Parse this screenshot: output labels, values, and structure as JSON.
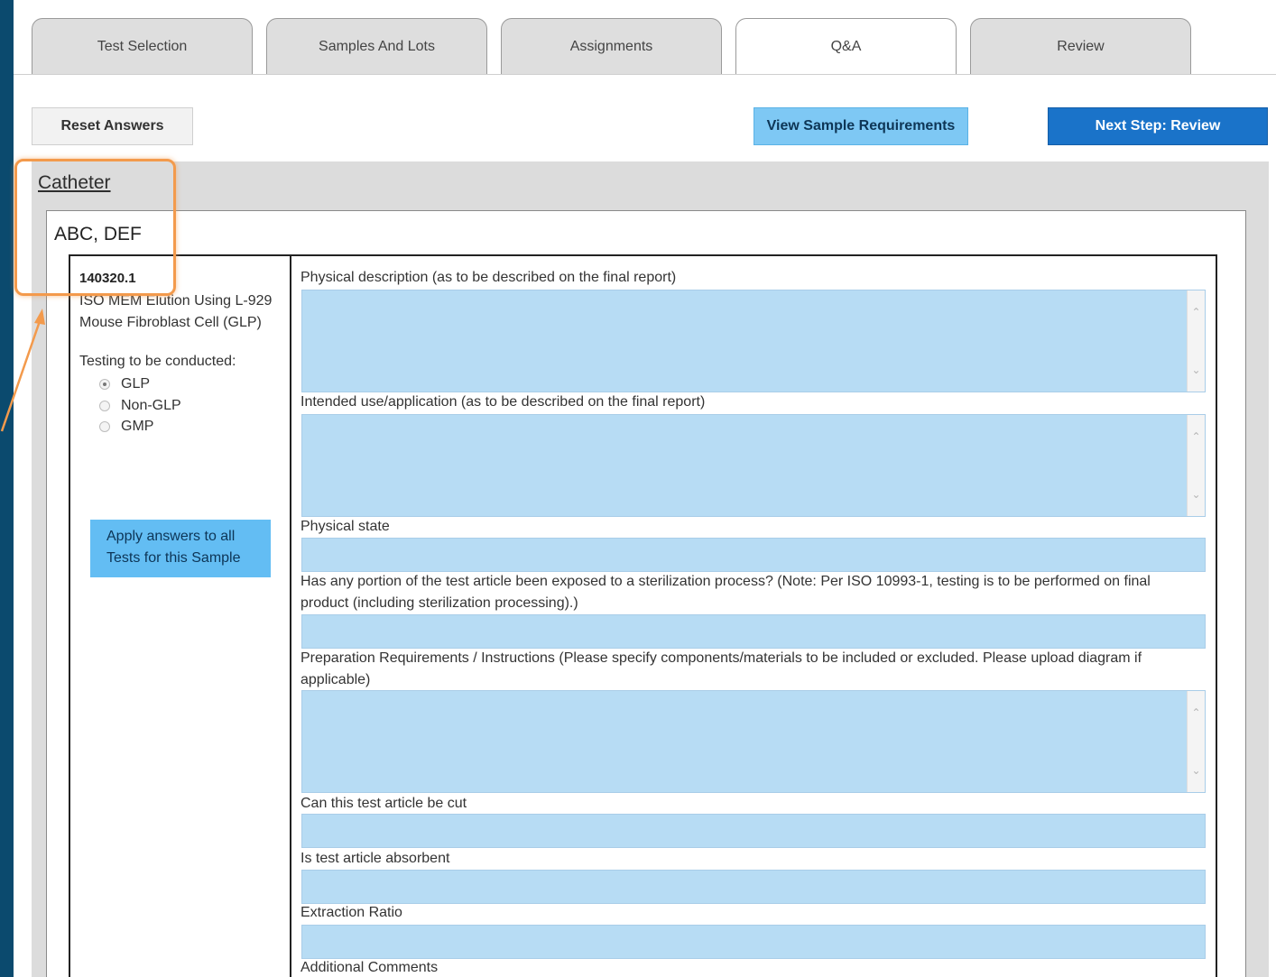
{
  "tabs": [
    {
      "label": "Test Selection",
      "active": false
    },
    {
      "label": "Samples And Lots",
      "active": false
    },
    {
      "label": "Assignments",
      "active": false
    },
    {
      "label": "Q&A",
      "active": true
    },
    {
      "label": "Review",
      "active": false
    }
  ],
  "toolbar": {
    "reset_label": "Reset Answers",
    "view_label": "View Sample Requirements",
    "next_label": "Next Step: Review"
  },
  "section": {
    "title": "Catheter",
    "sample_title": "ABC, DEF"
  },
  "test": {
    "id": "140320.1",
    "name": "ISO MEM Elution Using L-929 Mouse Fibroblast Cell (GLP)",
    "testing_label": "Testing to be conducted:",
    "options": [
      {
        "label": "GLP",
        "checked": true
      },
      {
        "label": "Non-GLP",
        "checked": false
      },
      {
        "label": "GMP",
        "checked": false
      }
    ],
    "apply_label": "Apply answers to all Tests for this Sample"
  },
  "questions": [
    {
      "label": "Physical description (as to be described on the final report)",
      "type": "textarea",
      "value": ""
    },
    {
      "label": "Intended use/application (as to be described on the final report)",
      "type": "textarea",
      "value": ""
    },
    {
      "label": "Physical state",
      "type": "input",
      "value": ""
    },
    {
      "label": "Has any portion of the test article been exposed to a sterilization process? (Note: Per ISO 10993-1, testing is to be performed on final product (including sterilization processing).)",
      "type": "input",
      "value": ""
    },
    {
      "label": "Preparation Requirements / Instructions (Please specify components/materials to be included or excluded. Please upload diagram if applicable)",
      "type": "textarea",
      "value": ""
    },
    {
      "label": "Can this test article be cut",
      "type": "input",
      "value": ""
    },
    {
      "label": "Is test article absorbent",
      "type": "input",
      "value": ""
    },
    {
      "label": "Extraction Ratio",
      "type": "input",
      "value": ""
    },
    {
      "label": "Additional Comments",
      "type": "textarea",
      "value": ""
    }
  ],
  "colors": {
    "page_border": "#0b4a6e",
    "field_fill": "#b7dcf4",
    "primary_button": "#1a73c9",
    "secondary_button": "#7ec8f4",
    "highlight": "#f39a4c"
  }
}
